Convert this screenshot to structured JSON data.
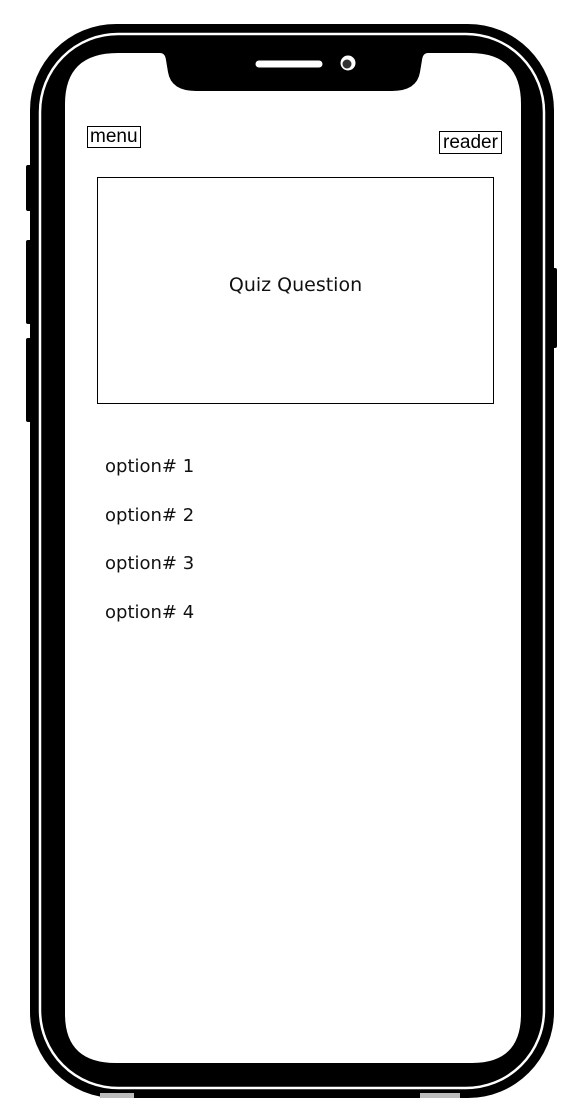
{
  "header": {
    "menu_label": "menu",
    "reader_label": "reader"
  },
  "quiz": {
    "question": "Quiz Question",
    "options": [
      "option# 1",
      "option# 2",
      "option# 3",
      "option# 4"
    ]
  },
  "colors": {
    "frame": "#000000",
    "screen": "#ffffff",
    "text": "#111111"
  }
}
